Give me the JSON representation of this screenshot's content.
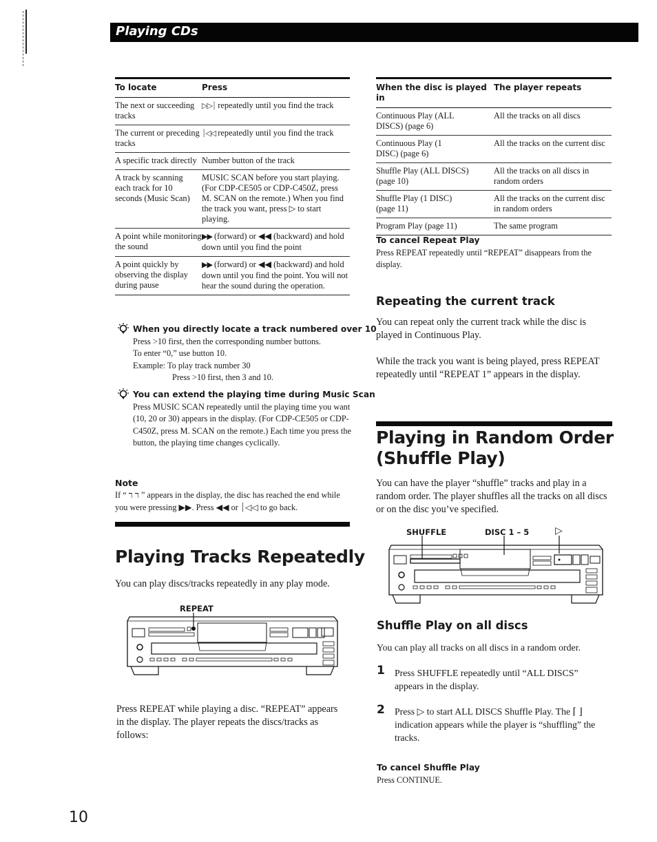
{
  "header": {
    "title": "Playing CDs"
  },
  "locate_table": {
    "headers": [
      "To locate",
      "Press"
    ],
    "rows": [
      {
        "locate": "The next or succeeding tracks",
        "press_icon": "▷▷⏐",
        "press": "repeatedly until you find the track"
      },
      {
        "locate": "The current or preceding tracks",
        "press_icon": "⏐◁◁",
        "press": "repeatedly until you find the track"
      },
      {
        "locate": "A specific track directly",
        "press_icon": "",
        "press": "Number button of the track"
      },
      {
        "locate": "A track by scanning each track for 10 seconds (Music Scan)",
        "press_icon": "",
        "press": "MUSIC SCAN before you start playing. (For CDP-CE505 or CDP-C450Z, press M. SCAN on the remote.) When you find the track you want, press ▷ to start playing."
      },
      {
        "locate": "A point while monitoring the sound",
        "press_icon": "▶▶",
        "press": "(forward) or ◀◀ (backward) and hold down until you find the point"
      },
      {
        "locate": "A point quickly by observing the display during pause",
        "press_icon": "▶▶",
        "press": "(forward) or ◀◀ (backward) and hold down until you find the point. You will not hear the sound during the operation."
      }
    ]
  },
  "tips": [
    {
      "title": "When you directly locate a track numbered over 10",
      "lines": [
        "Press >10 first, then the corresponding number buttons.",
        "To enter “0,” use button 10.",
        "Example:  To play track number 30",
        "Press >10 first, then 3 and 10."
      ]
    },
    {
      "title": "You can extend the playing time during Music Scan",
      "text": "Press MUSIC SCAN repeatedly until the playing time you want (10, 20 or 30) appears in the display. (For CDP-CE505 or CDP-C450Z, press M. SCAN on the remote.) Each time you press the button, the playing time changes cyclically."
    }
  ],
  "note": {
    "title": "Note",
    "text": "If “ ר ר ” appears in the display, the disc has reached the end while you were pressing ▶▶. Press ◀◀ or ⏐◁◁ to go back."
  },
  "repeat_section": {
    "title": "Playing Tracks Repeatedly",
    "intro": "You can play discs/tracks repeatedly in any play mode.",
    "diagram_label": "REPEAT",
    "instructions": "Press REPEAT while playing a disc. “REPEAT” appears in the display. The player repeats the discs/tracks as follows:"
  },
  "repeat_table": {
    "headers": [
      "When the disc is played in",
      "The player repeats"
    ],
    "rows": [
      {
        "mode": "Continuous Play (ALL DISCS) (page 6)",
        "repeats": "All the tracks on all discs"
      },
      {
        "mode": "Continuous Play (1 DISC) (page 6)",
        "repeats": "All the tracks on the current disc"
      },
      {
        "mode": "Shuffle Play (ALL DISCS) (page 10)",
        "repeats": "All the tracks on all discs in random orders"
      },
      {
        "mode": "Shuffle Play (1 DISC) (page 11)",
        "repeats": "All the tracks on the current disc in random orders"
      },
      {
        "mode": "Program Play (page 11)",
        "repeats": "The same program"
      }
    ]
  },
  "cancel_repeat": {
    "title": "To cancel Repeat Play",
    "text": "Press REPEAT repeatedly until “REPEAT” disappears from the display."
  },
  "repeat_current": {
    "title": "Repeating the current track",
    "para1": "You can repeat only the current track while the disc is played in Continuous Play.",
    "para2": "While the track you want is being played, press REPEAT repeatedly until “REPEAT 1” appears in the display."
  },
  "shuffle_section": {
    "title_line1": "Playing in Random Order",
    "title_line2": "(Shuffle Play)",
    "intro": "You can have the player “shuffle” tracks and play in a random order. The player shuffles all the tracks on all discs or on the disc you’ve specified.",
    "diagram_labels": [
      "SHUFFLE",
      "DISC 1 – 5",
      "▷"
    ]
  },
  "shuffle_all": {
    "title": "Shuffle Play on all discs",
    "intro": "You can play all tracks on all discs in a random order.",
    "steps": [
      {
        "num": "1",
        "text": "Press SHUFFLE repeatedly until “ALL DISCS” appears in the display."
      },
      {
        "num": "2",
        "text": "Press ▷ to start ALL DISCS Shuffle Play. The ⌈ ⌋ indication appears while the player is “shuffling” the tracks."
      }
    ]
  },
  "cancel_shuffle": {
    "title": "To cancel Shuffle Play",
    "text": "Press CONTINUE."
  },
  "page_number": "10"
}
